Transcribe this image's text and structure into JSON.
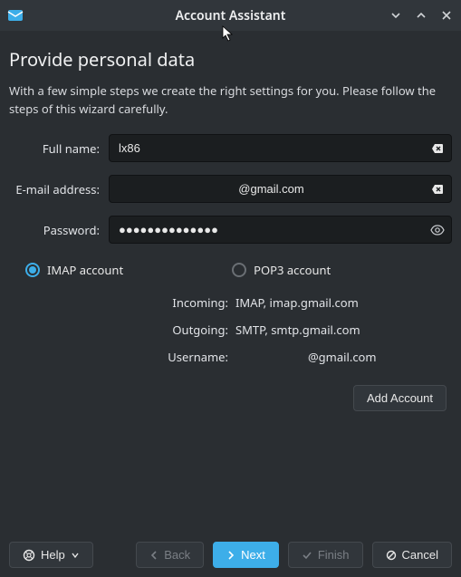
{
  "titlebar": {
    "title": "Account Assistant"
  },
  "heading": "Provide personal data",
  "description": "With a few simple steps we create the right settings for you. Please follow the steps of this wizard carefully.",
  "form": {
    "full_name_label": "Full name:",
    "full_name_value": "lx86",
    "email_label": "E-mail address:",
    "email_value": "@gmail.com",
    "password_label": "Password:",
    "password_value": "●●●●●●●●●●●●●●"
  },
  "account_type": {
    "imap_label": "IMAP account",
    "pop3_label": "POP3 account",
    "selected": "imap"
  },
  "server_info": {
    "incoming_label": "Incoming:",
    "incoming_value": "IMAP, imap.gmail.com",
    "outgoing_label": "Outgoing:",
    "outgoing_value": "SMTP, smtp.gmail.com",
    "username_label": "Username:",
    "username_value": "@gmail.com"
  },
  "buttons": {
    "add_account": "Add Account",
    "help": "Help",
    "back": "Back",
    "next": "Next",
    "finish": "Finish",
    "cancel": "Cancel"
  }
}
